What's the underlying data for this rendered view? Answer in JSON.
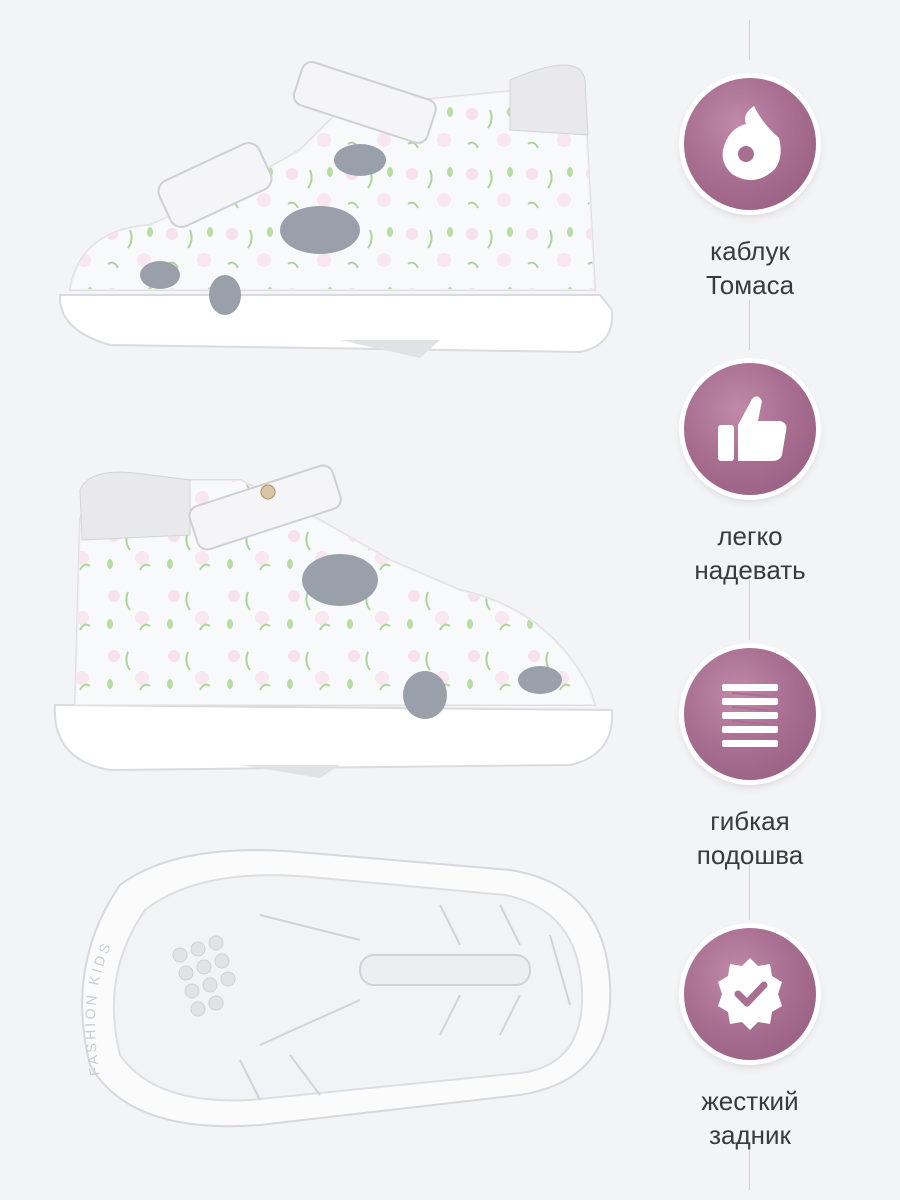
{
  "features": [
    {
      "icon": "heel-icon",
      "line1": "каблук",
      "line2": "Томаса"
    },
    {
      "icon": "thumbs-up-icon",
      "line1": "легко",
      "line2": "надевать"
    },
    {
      "icon": "flexible-sole-icon",
      "line1": "гибкая",
      "line2": "подошва"
    },
    {
      "icon": "badge-check-icon",
      "line1": "жесткий",
      "line2": "задник"
    }
  ],
  "sole_text": {
    "brand": "FASHION KIDS"
  },
  "colors": {
    "badge": "#a86f91",
    "line": "#d8cbd3",
    "text": "#3a3a3a",
    "background": "#f3f4f6"
  }
}
